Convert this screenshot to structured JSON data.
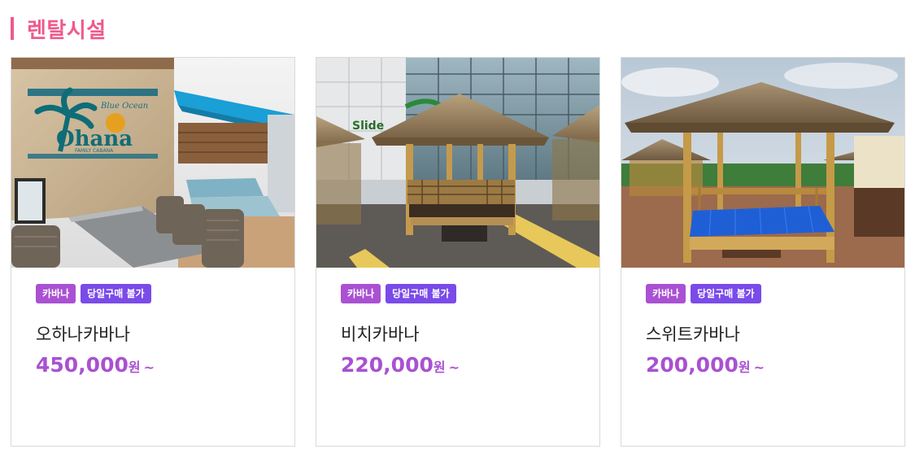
{
  "section": {
    "title": "렌탈시설"
  },
  "cards": [
    {
      "tags": [
        "카바나",
        "당일구매 불가"
      ],
      "name": "오하나카바나",
      "price": "450,000",
      "unit": "원",
      "suffix": "~",
      "photo_sign": "Ohana",
      "photo_sign_sub": "Blue Ocean",
      "photo_sign_caption": "FAMILY CABANA"
    },
    {
      "tags": [
        "카바나",
        "당일구매 불가"
      ],
      "name": "비치카바나",
      "price": "220,000",
      "unit": "원",
      "suffix": "~",
      "photo_sign": "Slide"
    },
    {
      "tags": [
        "카바나",
        "당일구매 불가"
      ],
      "name": "스위트카바나",
      "price": "200,000",
      "unit": "원",
      "suffix": "~"
    }
  ],
  "colors": {
    "accent_pink": "#ef5a8c",
    "price_purple": "#a951d2",
    "tag_purple": "#a951d2",
    "tag_violet": "#7a4be8"
  },
  "icons": {}
}
